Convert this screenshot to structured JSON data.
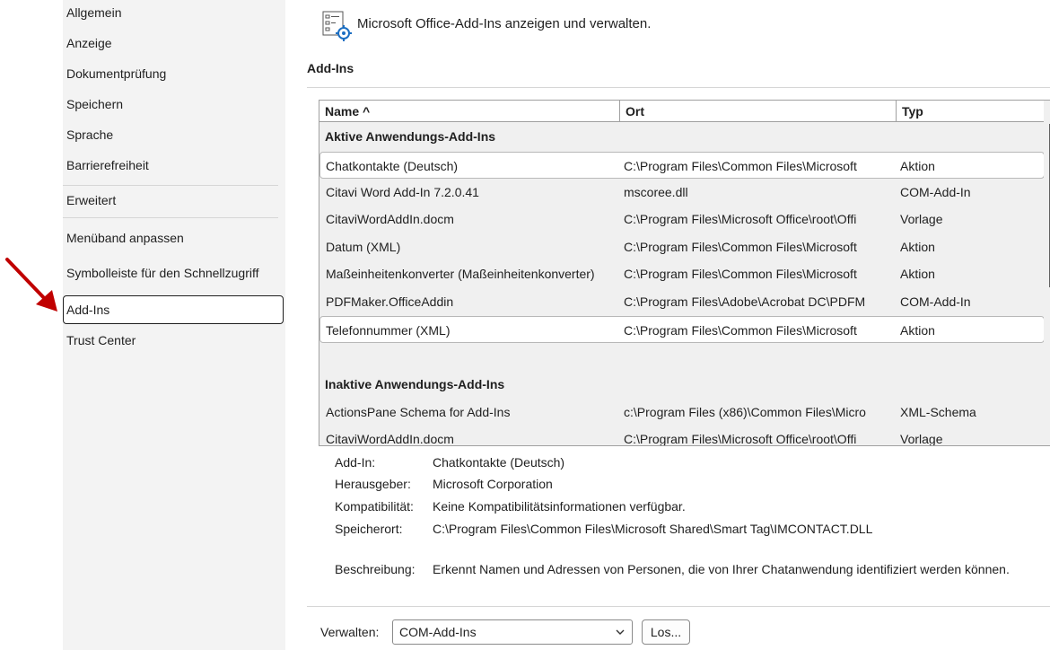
{
  "nav": {
    "items": [
      {
        "label": "Allgemein"
      },
      {
        "label": "Anzeige"
      },
      {
        "label": "Dokumentprüfung"
      },
      {
        "label": "Speichern"
      },
      {
        "label": "Sprache"
      },
      {
        "label": "Barrierefreiheit"
      },
      {
        "label": "Erweitert"
      },
      {
        "label": "Menüband anpassen"
      },
      {
        "label": "Symbolleiste für den Schnellzugriff"
      },
      {
        "label": "Add-Ins"
      },
      {
        "label": "Trust Center"
      }
    ],
    "selected": "Add-Ins"
  },
  "header": {
    "text": "Microsoft Office-Add-Ins anzeigen und verwalten.",
    "icon": "addins-gear-icon"
  },
  "section_title": "Add-Ins",
  "table": {
    "columns": [
      {
        "label": "Name ^"
      },
      {
        "label": "Ort"
      },
      {
        "label": "Typ"
      }
    ],
    "groups": [
      {
        "title": "Aktive Anwendungs-Add-Ins",
        "rows": [
          {
            "name": "Chatkontakte (Deutsch)",
            "location": "C:\\Program Files\\Common Files\\Microsoft",
            "type": "Aktion"
          },
          {
            "name": "Citavi Word Add-In 7.2.0.41",
            "location": "mscoree.dll",
            "type": "COM-Add-In"
          },
          {
            "name": "CitaviWordAddIn.docm",
            "location": "C:\\Program Files\\Microsoft Office\\root\\Offi",
            "type": "Vorlage"
          },
          {
            "name": "Datum (XML)",
            "location": "C:\\Program Files\\Common Files\\Microsoft",
            "type": "Aktion"
          },
          {
            "name": "Maßeinheitenkonverter (Maßeinheitenkonverter)",
            "location": "C:\\Program Files\\Common Files\\Microsoft",
            "type": "Aktion"
          },
          {
            "name": "PDFMaker.OfficeAddin",
            "location": "C:\\Program Files\\Adobe\\Acrobat DC\\PDFM",
            "type": "COM-Add-In"
          },
          {
            "name": "Telefonnummer (XML)",
            "location": "C:\\Program Files\\Common Files\\Microsoft",
            "type": "Aktion"
          }
        ]
      },
      {
        "title": "Inaktive Anwendungs-Add-Ins",
        "rows": [
          {
            "name": "ActionsPane Schema for Add-Ins",
            "location": "c:\\Program Files (x86)\\Common Files\\Micro",
            "type": "XML-Schema"
          },
          {
            "name": "CitaviWordAddIn.docm",
            "location": "C:\\Program Files\\Microsoft Office\\root\\Offi",
            "type": "Vorlage"
          }
        ]
      }
    ]
  },
  "details": {
    "addin_label": "Add-In:",
    "addin_value": "Chatkontakte (Deutsch)",
    "publisher_label": "Herausgeber:",
    "publisher_value": "Microsoft Corporation",
    "compat_label": "Kompatibilität:",
    "compat_value": "Keine Kompatibilitätsinformationen verfügbar.",
    "location_label": "Speicherort:",
    "location_value": "C:\\Program Files\\Common Files\\Microsoft Shared\\Smart Tag\\IMCONTACT.DLL",
    "desc_label": "Beschreibung:",
    "desc_value": "Erkennt Namen und Adressen von Personen, die von Ihrer Chatanwendung identifiziert werden können."
  },
  "manage": {
    "label": "Verwalten:",
    "selected": "COM-Add-Ins",
    "go_label": "Los..."
  },
  "colors": {
    "nav_bg": "#f3f3f3",
    "arrow": "#c00000",
    "border": "#a0a0a0"
  }
}
